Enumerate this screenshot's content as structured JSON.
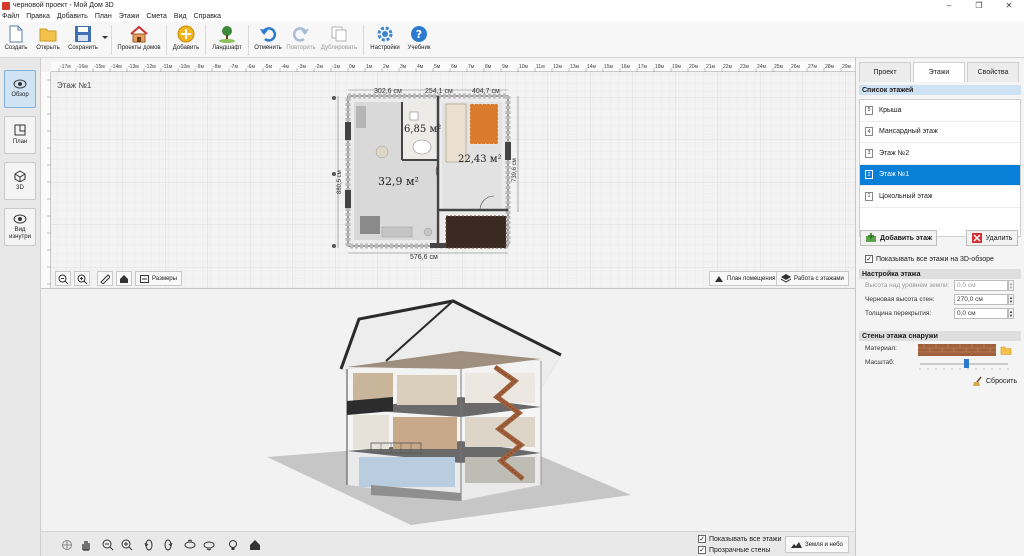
{
  "window": {
    "title": "черновой проект - Мой Дом 3D",
    "min": "–",
    "max": "❐",
    "close": "✕"
  },
  "menu": [
    "Файл",
    "Правка",
    "Добавить",
    "План",
    "Этажи",
    "Смета",
    "Вид",
    "Справка"
  ],
  "toolbar": {
    "create": "Создать",
    "open": "Открыть",
    "save": "Сохранить",
    "projects": "Проекты домов",
    "add": "Добавить",
    "landscape": "Ландшафт",
    "undo": "Отменить",
    "redo": "Повторить",
    "duplicate": "Дублировать",
    "settings": "Настройки",
    "tutorial": "Учебник"
  },
  "leftbar": {
    "overview": "Обзор",
    "plan": "План",
    "view3d": "3D",
    "inside": "Вид изнутри"
  },
  "plan": {
    "floor_label": "Этаж №1",
    "ruler_labels": [
      "-17м",
      "-16м",
      "-15м",
      "-14м",
      "-13м",
      "-12м",
      "-11м",
      "-10м",
      "-9м",
      "-8м",
      "-7м",
      "-6м",
      "-5м",
      "-4м",
      "-3м",
      "-2м",
      "-1м",
      "0м",
      "1м",
      "2м",
      "3м",
      "4м",
      "5м",
      "6м",
      "7м",
      "8м",
      "9м",
      "10м",
      "11м",
      "12м",
      "13м",
      "14м",
      "15м",
      "16м",
      "17м",
      "18м",
      "19м",
      "20м",
      "21м",
      "22м",
      "23м",
      "24м",
      "25м",
      "26м",
      "27м",
      "28м",
      "29м",
      "30м"
    ],
    "dim_top": [
      "302,6 см",
      "254,1 см",
      "404,7 см"
    ],
    "dim_bottom": "576,6 см",
    "dim_left": "880,5 см",
    "dim_right": "739,6 см",
    "room1_area": "32,9 м²",
    "room2_area": "6,85 м²",
    "room3_area": "22,43 м²",
    "sizes_btn": "Размеры",
    "room_plan_btn": "План помещения",
    "floors_btn": "Работа с этажами"
  },
  "bottom": {
    "show_all_floors": "Показывать все этажи",
    "transparent_walls": "Прозрачные стены",
    "ground_sky": "Земля и небо"
  },
  "panel": {
    "tabs": [
      "Проект",
      "Этажи",
      "Свойства"
    ],
    "floors_header": "Список этажей",
    "floors": [
      {
        "num": "5",
        "name": "Крыша"
      },
      {
        "num": "4",
        "name": "Мансардный этаж"
      },
      {
        "num": "3",
        "name": "Этаж №2"
      },
      {
        "num": "2",
        "name": "Этаж №1"
      },
      {
        "num": "1",
        "name": "Цокольный этаж"
      }
    ],
    "add_floor": "Добавить этаж",
    "delete": "Удалить",
    "show_all_3d": "Показывать все этажи на 3D-обзоре",
    "settings_header": "Настройка этажа",
    "height_label": "Высота над уровнем земли:",
    "height_value": "0,0 см",
    "rough_label": "Черновая высота стен:",
    "rough_value": "270,0 см",
    "slab_label": "Толщина перекрытия:",
    "slab_value": "0,0 см",
    "walls_header": "Стены этажа снаружи",
    "material_label": "Материал:",
    "scale_label": "Масштаб:",
    "reset": "Сбросить"
  },
  "colors": {
    "accent": "#0a7fd8",
    "brick": "#a0603c"
  }
}
